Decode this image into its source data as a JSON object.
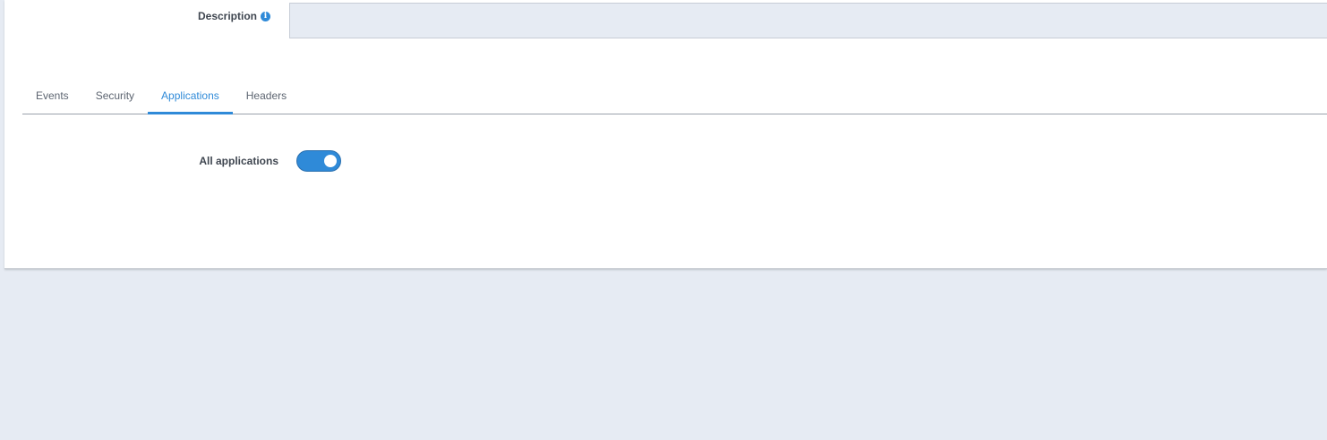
{
  "description": {
    "label": "Description",
    "value": "",
    "placeholder": ""
  },
  "tabs": [
    {
      "label": "Events",
      "active": false
    },
    {
      "label": "Security",
      "active": false
    },
    {
      "label": "Applications",
      "active": true
    },
    {
      "label": "Headers",
      "active": false
    }
  ],
  "applications": {
    "all_applications_label": "All applications",
    "all_applications_enabled": true
  },
  "colors": {
    "accent": "#2f8ad8",
    "page_background": "#e6ebf3",
    "input_background": "#e6ebf3",
    "card_background": "#ffffff"
  },
  "icons": {
    "description_info": "info-icon"
  }
}
